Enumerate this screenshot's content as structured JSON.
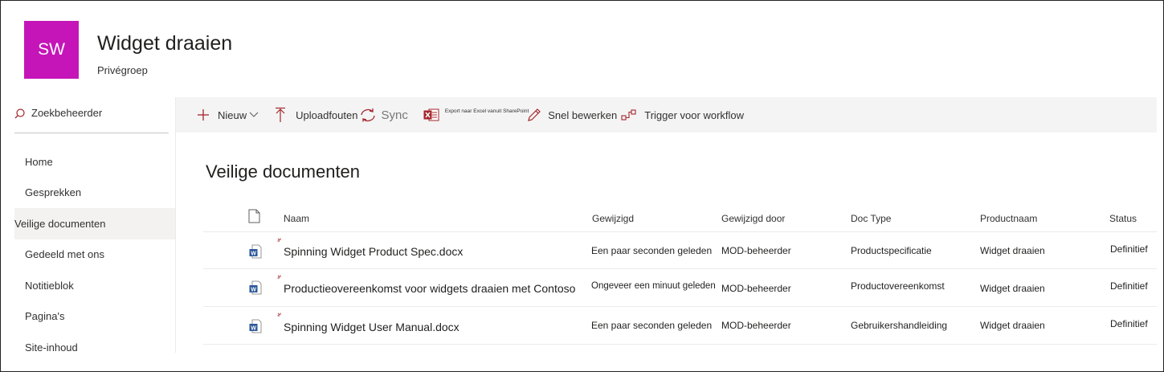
{
  "site": {
    "logo_initials": "SW",
    "title": "Widget draaien",
    "subtitle": "Privégroep"
  },
  "search": {
    "label": "Zoekbeheerder"
  },
  "nav": {
    "items": [
      {
        "label": "Home"
      },
      {
        "label": "Gesprekken"
      },
      {
        "label": "Veilige documenten",
        "active": true
      },
      {
        "label": "Gedeeld met ons"
      },
      {
        "label": "Notitieblok"
      },
      {
        "label": "Pagina's"
      },
      {
        "label": "Site-inhoud"
      }
    ]
  },
  "commandbar": {
    "new_label": "Nieuw",
    "upload_label": "Uploadfouten",
    "sync_label": "Sync",
    "export_label": "Export naar Excel vanuit SharePoint",
    "quickedit_label": "Snel bewerken",
    "flow_label": "Trigger voor workflow"
  },
  "library": {
    "title": "Veilige documenten",
    "columns": {
      "name": "Naam",
      "modified": "Gewijzigd",
      "modified_by": "Gewijzigd door",
      "doc_type": "Doc Type",
      "product": "Productnaam",
      "status": "Status"
    },
    "rows": [
      {
        "name": "Spinning Widget Product Spec.docx",
        "modified": "Een paar seconden geleden",
        "modified_by": "MOD-beheerder",
        "doc_type": "Productspecificatie",
        "product": "Widget draaien",
        "status": "Definitief"
      },
      {
        "name": "Productieovereenkomst voor widgets draaien met Contoso",
        "modified": "Ongeveer een minuut geleden",
        "modified_by": "MOD-beheerder",
        "doc_type": "Productovereenkomst",
        "product": "Widget draaien",
        "status": "Definitief"
      },
      {
        "name": "Spinning Widget User Manual.docx",
        "modified": "Een paar seconden geleden",
        "modified_by": "MOD-beheerder",
        "doc_type": "Gebruikershandleiding",
        "product": "Widget draaien",
        "status": "Definitief"
      }
    ]
  },
  "colors": {
    "logo_bg": "#c515b8",
    "accent": "#a4262c",
    "word_blue": "#2b579a"
  },
  "icons": {
    "search": "search-icon",
    "new": "plus-icon",
    "upload": "upload-arrow-icon",
    "sync": "sync-icon",
    "excel": "excel-icon",
    "edit": "pencil-icon",
    "flow": "flow-icon",
    "file_header": "document-icon",
    "word": "word-file-icon"
  }
}
